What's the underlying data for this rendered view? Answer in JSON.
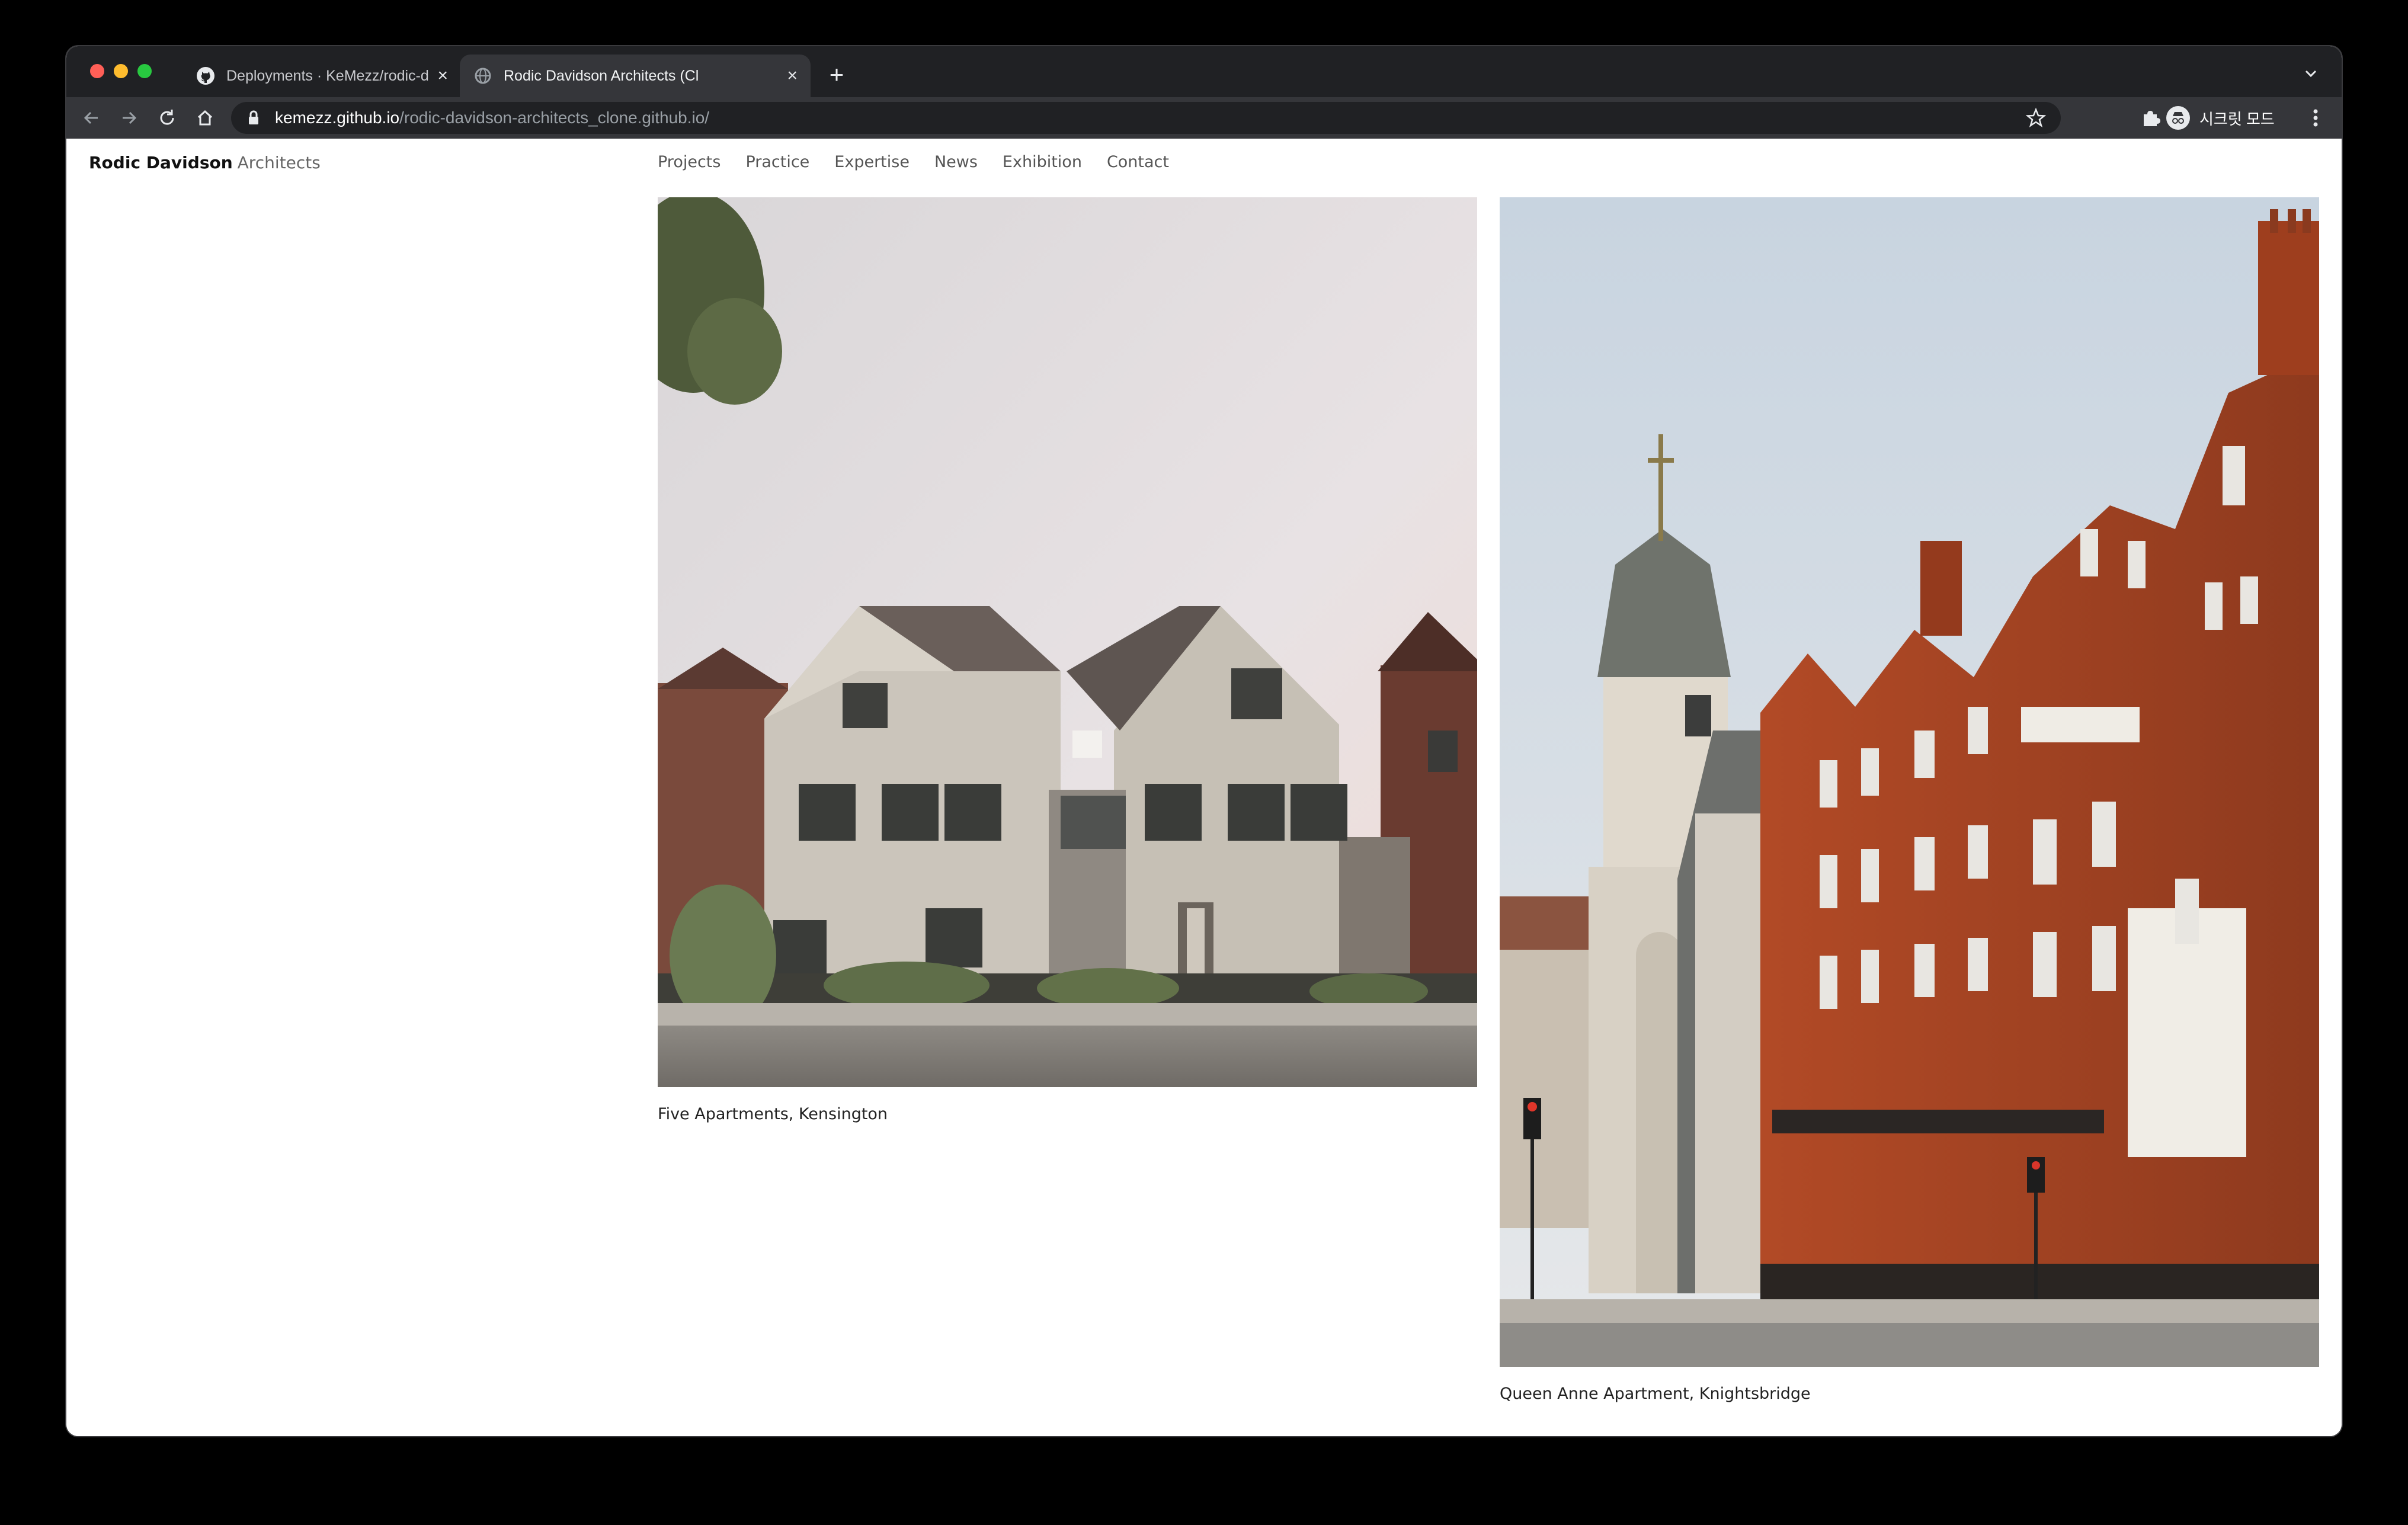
{
  "browser": {
    "tabs": [
      {
        "title": "Deployments · KeMezz/rodic-d",
        "icon": "github-icon"
      },
      {
        "title": "Rodic Davidson Architects (Cl",
        "icon": "globe-icon"
      }
    ],
    "url_host": "kemezz.github.io",
    "url_path": "/rodic-davidson-architects_clone.github.io/",
    "profile_label": "시크릿 모드"
  },
  "site": {
    "logo_primary": "Rodic Davidson",
    "logo_secondary": "Architects",
    "nav": [
      "Projects",
      "Practice",
      "Expertise",
      "News",
      "Exhibition",
      "Contact"
    ]
  },
  "projects": [
    {
      "caption": "Five Apartments, Kensington"
    },
    {
      "caption": "Queen Anne Apartment, Knightsbridge"
    }
  ],
  "colors": {
    "tabstrip": "#202124",
    "toolbar": "#35363a",
    "brick": "#9a3d22",
    "stone": "#cfc8bc"
  }
}
